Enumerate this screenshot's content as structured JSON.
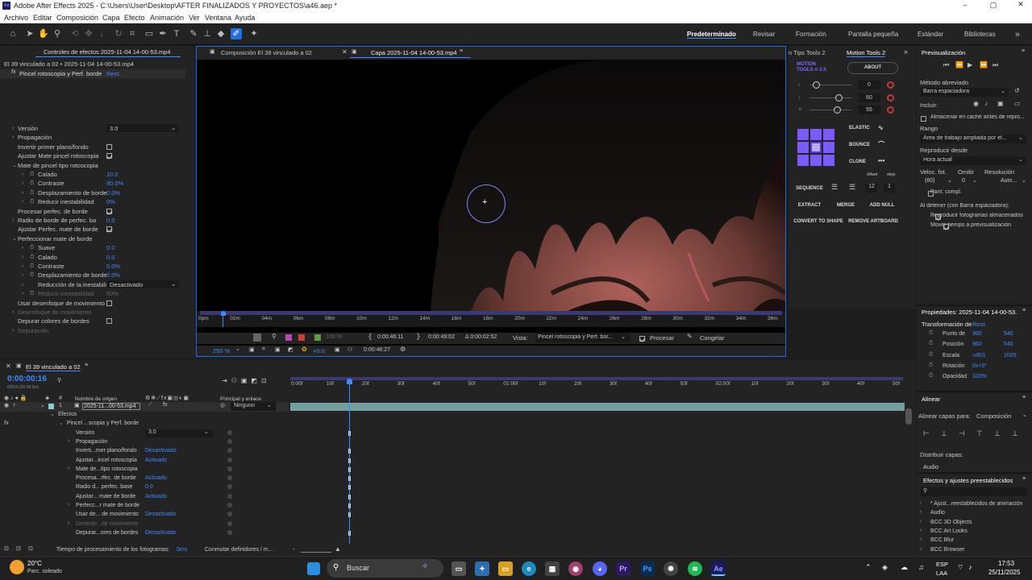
{
  "window": {
    "title": "Adobe After Effects 2025 - C:\\Users\\User\\Desktop\\AFTER FINALIZADOS Y PROYECTOS\\a46.aep *"
  },
  "menu": [
    "Archivo",
    "Editar",
    "Composición",
    "Capa",
    "Efecto",
    "Animación",
    "Ver",
    "Ventana",
    "Ayuda"
  ],
  "workspaces": [
    "Predeterminado",
    "Revisar",
    "Formación",
    "Pantalla pequeña",
    "Estándar",
    "Bibliotecas"
  ],
  "effects_panel": {
    "tab": "Controles de efectos 2025-11-04 14-00-53.mp4",
    "breadcrumb": "El 39 vinculado a 02 • 2025-11-04 14-00-53.mp4",
    "effect_name": "Pincel rotoscopia y Perf. borde",
    "reset": "Rest.",
    "rows": [
      {
        "label": "Versión",
        "value": "3.0",
        "type": "select",
        "indent": 1
      },
      {
        "label": "Propagación",
        "value": "",
        "type": "group",
        "indent": 1
      },
      {
        "label": "Invertir primer plano/fondo",
        "value": "",
        "type": "check",
        "checked": false,
        "indent": 1
      },
      {
        "label": "Ajustar Mate pincel rotoscopia",
        "value": "",
        "type": "check",
        "checked": true,
        "indent": 1
      },
      {
        "label": "Mate de pincel tipo rotoscopia",
        "value": "",
        "type": "open",
        "indent": 1
      },
      {
        "label": "Calado",
        "value": "10.0",
        "type": "value",
        "indent": 2
      },
      {
        "label": "Contraste",
        "value": "80.0%",
        "type": "value",
        "indent": 2
      },
      {
        "label": "Desplazamiento de borde",
        "value": "0.0%",
        "type": "value",
        "indent": 2
      },
      {
        "label": "Reducir inestabilidad",
        "value": "0%",
        "type": "value",
        "indent": 2
      },
      {
        "label": "Procesar perfec. de borde",
        "value": "",
        "type": "check",
        "checked": true,
        "indent": 1
      },
      {
        "label": "Radio de borde de perfec. ba",
        "value": "0.0",
        "type": "value",
        "indent": 1
      },
      {
        "label": "Ajustar Perfec. mate de borde",
        "value": "",
        "type": "check",
        "checked": true,
        "indent": 1
      },
      {
        "label": "Perfeccionar mate de borde",
        "value": "",
        "type": "open",
        "indent": 1
      },
      {
        "label": "Suave",
        "value": "0.0",
        "type": "value",
        "indent": 2
      },
      {
        "label": "Calado",
        "value": "0.0",
        "type": "value",
        "indent": 2
      },
      {
        "label": "Contraste",
        "value": "0.0%",
        "type": "value",
        "indent": 2
      },
      {
        "label": "Desplazamiento de borde",
        "value": "0.0%",
        "type": "value",
        "indent": 2
      },
      {
        "label": "Reducción de la inestabili",
        "value": "Desactivado",
        "type": "select",
        "indent": 2
      },
      {
        "label": "Reducir inestabilidad",
        "value": "50%",
        "type": "dim",
        "indent": 2
      },
      {
        "label": "Usar desenfoque de movimiento",
        "value": "",
        "type": "check",
        "checked": false,
        "indent": 1
      },
      {
        "label": "Desenfoque de movimiento",
        "value": "",
        "type": "dimgroup",
        "indent": 1
      },
      {
        "label": "Depurar colores de bordes",
        "value": "",
        "type": "check",
        "checked": false,
        "indent": 1
      },
      {
        "label": "Depuración",
        "value": "",
        "type": "dimgroup",
        "indent": 1
      }
    ]
  },
  "viewer": {
    "tabs": [
      "Composición El 39 vinculado a 02",
      "Capa 2025-11-04 14-00-53.mp4"
    ],
    "ruler": [
      "0pm",
      "02m",
      "04m",
      "06m",
      "08m",
      "10m",
      "12m",
      "14m",
      "16m",
      "18m",
      "20m",
      "22m",
      "24m",
      "26m",
      "28m",
      "30m",
      "32m",
      "34m",
      "36m"
    ],
    "progress_fraction": 0.02,
    "controls1": {
      "zoom_pct": "100 %",
      "in": "0:00:46:11",
      "out": "0:00:49:02",
      "dur": "Δ 0:00:02:52",
      "vista_label": "Vista:",
      "vista": "Pincel rotoscopia y Perf. bor...",
      "procesar": "Procesar",
      "congelar": "Congelar"
    },
    "controls2": {
      "zoom": "250 %",
      "exposure": "+0.0",
      "time": "0:00:46:27"
    }
  },
  "motion_tools": {
    "tabs": [
      "n Tips Tools 2",
      "Motion Tools 2"
    ],
    "logo1": "MOTION",
    "logo2": "TOOLS ® 2.0",
    "about": "ABOUT",
    "sliders": [
      {
        "value": "0"
      },
      {
        "value": "60"
      },
      {
        "value": "55"
      }
    ],
    "buttons": [
      "ELASTIC",
      "BOUNCE",
      "CLONE"
    ],
    "small_labels": [
      "offset",
      "step"
    ],
    "seq": "SEQUENCE",
    "seq_offset": "12",
    "seq_step": "1",
    "row2": [
      "EXTRACT",
      "MERGE",
      "ADD NULL"
    ],
    "row3": [
      "CONVERT TO SHAPE",
      "REMOVE ARTBOARD"
    ]
  },
  "preview": {
    "title": "Previsualización",
    "method_label": "Método abreviado",
    "method": "Barra espaciadora",
    "include": "Incluir:",
    "cache": "Almacenar en caché antes de repro...",
    "range_label": "Rango",
    "range": "Área de trabajo ampliada por el...",
    "play_from_label": "Reproducir desde",
    "play_from": "Hora actual",
    "fps_label": "Veloc. fot.",
    "skip_label": "Omitir",
    "res_label": "Resolución",
    "fps": "(60)",
    "skip": "0",
    "res": "Auto...",
    "fullscreen": "Pant. compl.",
    "stop_label": "Al detener (con Barra espaciadora):",
    "cached": "Reproducir fotogramas almacenados",
    "move": "Mover tiempo a previsualización"
  },
  "properties": {
    "title": "Propiedades: 2025-11-04 14-00-53.",
    "transform": "Transformación de",
    "reset": "Rest.",
    "rows": [
      {
        "label": "Punto de",
        "v1": "960",
        "v2": "540"
      },
      {
        "label": "Posición",
        "v1": "960",
        "v2": "540"
      },
      {
        "label": "Escala",
        "v1": "∞801",
        "v2": "1005"
      },
      {
        "label": "Rotación",
        "v1": "0x+0°",
        "v2": ""
      },
      {
        "label": "Opacidad",
        "v1": "100%",
        "v2": ""
      }
    ]
  },
  "align": {
    "title": "Alinear",
    "align_to_label": "Alinear capas para:",
    "align_to": "Composición",
    "distribute": "Distribuir capas:",
    "audio": "Audio"
  },
  "effects_presets": {
    "title": "Efectos y ajustes preestablecidos",
    "items": [
      "* Ajust...reestablecidos de animación",
      "Audio",
      "BCC 3D Objects",
      "BCC Art Looks",
      "BCC Blur",
      "BCC Browser"
    ]
  },
  "timeline": {
    "tab": "El 39 vinculado a 02",
    "timecode": "0:00:00:16",
    "timecode_sub": "00016 (60.00 fps)",
    "col_source": "Nombre de origen",
    "col_parent": "Principal y enlace",
    "layer_num": "1",
    "layer_name": "2025-11...00-53.mp4",
    "parent": "Ninguno",
    "ruler": [
      "0:00f",
      "10f",
      "20f",
      "30f",
      "40f",
      "50f",
      "01:00f",
      "10f",
      "20f",
      "30f",
      "40f",
      "50f",
      "02:00f",
      "10f",
      "20f",
      "30f",
      "40f",
      "50f"
    ],
    "rows": [
      {
        "label": "Efectos",
        "value": "",
        "indent": 0
      },
      {
        "label": "Pincel ...scopia y Perf. borde",
        "value": "",
        "indent": 1
      },
      {
        "label": "Versión",
        "value": "3.0",
        "indent": 2
      },
      {
        "label": "Propagación",
        "value": "",
        "indent": 2
      },
      {
        "label": "Inverti...mer plano/fondo",
        "value": "Desactivado",
        "indent": 2
      },
      {
        "label": "Ajustar...incel rotoscopia",
        "value": "Activado",
        "indent": 2
      },
      {
        "label": "Mate de...tipo rotoscopia",
        "value": "",
        "indent": 2
      },
      {
        "label": "Procesa...rfec. de borde",
        "value": "Activado",
        "indent": 2
      },
      {
        "label": "Radio d... perfec. base",
        "value": "0.0",
        "indent": 2
      },
      {
        "label": "Ajustar... mate de borde",
        "value": "Activado",
        "indent": 2
      },
      {
        "label": "Perfecc...r mate de borde",
        "value": "",
        "indent": 2
      },
      {
        "label": "Usar de... de movimiento",
        "value": "Desactivado",
        "indent": 2
      },
      {
        "label": "Desenfo...de movimiento",
        "value": "",
        "indent": 2
      },
      {
        "label": "Depurar...ores de bordes",
        "value": "Desactivado",
        "indent": 2
      }
    ],
    "status": "Tiempo de procesamiento de los fotogramas:",
    "status_value": "0ms",
    "toggle": "Conmutar definidores / m..."
  },
  "taskbar": {
    "weather_temp": "20°C",
    "weather_desc": "Parc. soleado",
    "search": "Buscar",
    "lang1": "ESP",
    "lang2": "LAA",
    "time": "17:53",
    "date": "25/11/2025"
  }
}
